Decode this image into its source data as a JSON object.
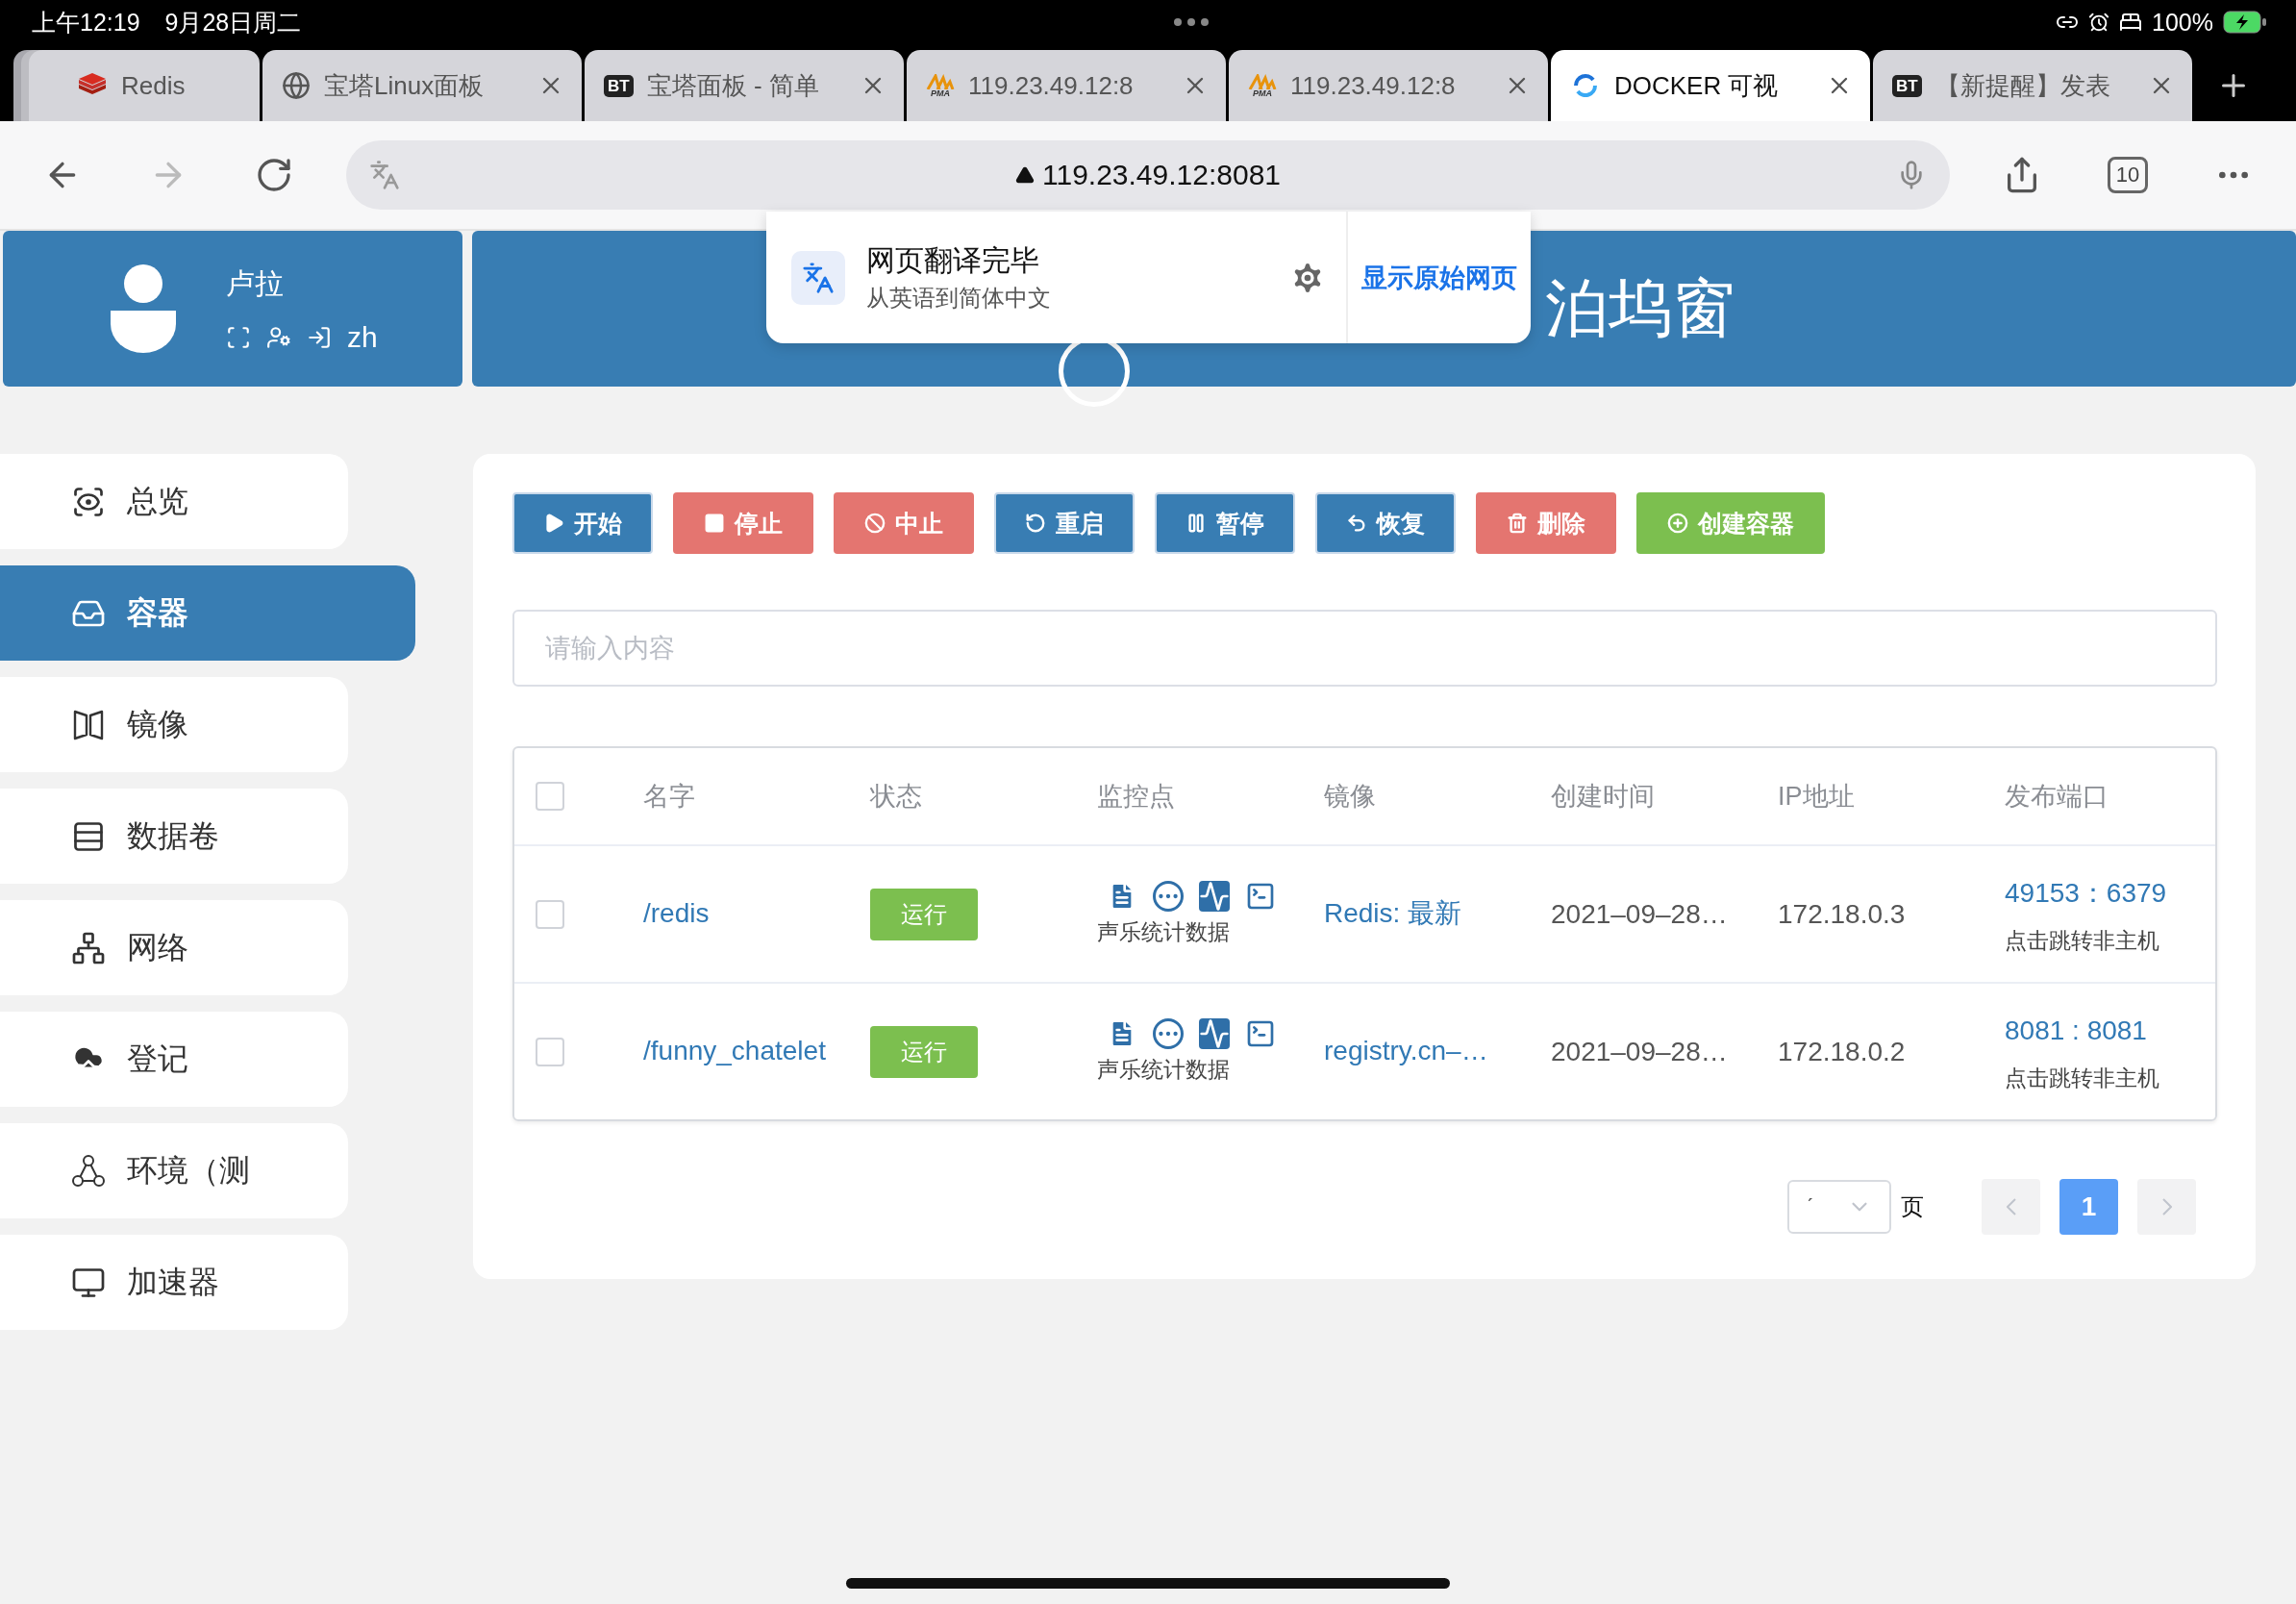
{
  "status_bar": {
    "time": "上午12:19",
    "date": "9月28日周二",
    "battery": "100%"
  },
  "browser_tabs": [
    {
      "kind": "redis",
      "title": "Redis",
      "selected": false,
      "closable": false
    },
    {
      "kind": "globe",
      "title": "宝塔Linux面板",
      "selected": false,
      "closable": true
    },
    {
      "kind": "bt",
      "icon_label": "BT",
      "title": "宝塔面板 - 简单",
      "selected": false,
      "closable": true
    },
    {
      "kind": "pma",
      "icon_label": "PMA",
      "title": "119.23.49.12:8",
      "selected": false,
      "closable": true
    },
    {
      "kind": "pma",
      "icon_label": "PMA",
      "title": "119.23.49.12:8",
      "selected": false,
      "closable": true
    },
    {
      "kind": "docker",
      "title": "DOCKER 可视",
      "selected": true,
      "closable": true
    },
    {
      "kind": "bt",
      "icon_label": "BT",
      "title": "【新提醒】发表",
      "selected": false,
      "closable": true
    }
  ],
  "address_bar": {
    "url": "119.23.49.12:8081",
    "tab_count": "10"
  },
  "user": {
    "name": "卢拉",
    "language": "zh"
  },
  "translate_popup": {
    "title": "网页翻译完毕",
    "subtitle": "从英语到简体中文",
    "action": "显示原始网页"
  },
  "header": {
    "title": "泊坞窗"
  },
  "sidebar": {
    "items": [
      {
        "kind": "overview",
        "label": "总览",
        "selected": false
      },
      {
        "kind": "container",
        "label": "容器",
        "selected": true
      },
      {
        "kind": "image",
        "label": "镜像",
        "selected": false
      },
      {
        "kind": "volume",
        "label": "数据卷",
        "selected": false
      },
      {
        "kind": "network",
        "label": "网络",
        "selected": false
      },
      {
        "kind": "registry",
        "label": "登记",
        "selected": false
      },
      {
        "kind": "environment",
        "label": "环境（测",
        "selected": false
      },
      {
        "kind": "accelerator",
        "label": "加速器",
        "selected": false
      }
    ]
  },
  "toolbar": [
    {
      "kind": "start",
      "label": "开始"
    },
    {
      "kind": "stop",
      "label": "停止"
    },
    {
      "kind": "kill",
      "label": "中止"
    },
    {
      "kind": "restart",
      "label": "重启"
    },
    {
      "kind": "pause",
      "label": "暂停"
    },
    {
      "kind": "resume",
      "label": "恢复"
    },
    {
      "kind": "delete",
      "label": "删除"
    },
    {
      "kind": "create",
      "label": "创建容器"
    }
  ],
  "search": {
    "placeholder": "请输入内容"
  },
  "table": {
    "select_all_checked": false,
    "columns": [
      "名字",
      "状态",
      "监控点",
      "镜像",
      "创建时间",
      "IP地址",
      "发布端口"
    ],
    "rows": [
      {
        "checked": false,
        "name": "/redis",
        "status": "运行",
        "monitor": "声乐统计数据",
        "image": "Redis: 最新",
        "created": "2021–09–28…",
        "ip": "172.18.0.3",
        "port": "49153：6379",
        "port_hint": "点击跳转非主机"
      },
      {
        "checked": false,
        "name": "/funny_chatelet",
        "status": "运行",
        "monitor": "声乐统计数据",
        "image": "registry.cn–…",
        "created": "2021–09–28…",
        "ip": "172.18.0.2",
        "port": "8081 : 8081",
        "port_hint": "点击跳转非主机"
      }
    ]
  },
  "pagination": {
    "page_size": "ˊ",
    "unit": "页",
    "pages": [
      {
        "label": "1",
        "selected": true
      }
    ]
  }
}
